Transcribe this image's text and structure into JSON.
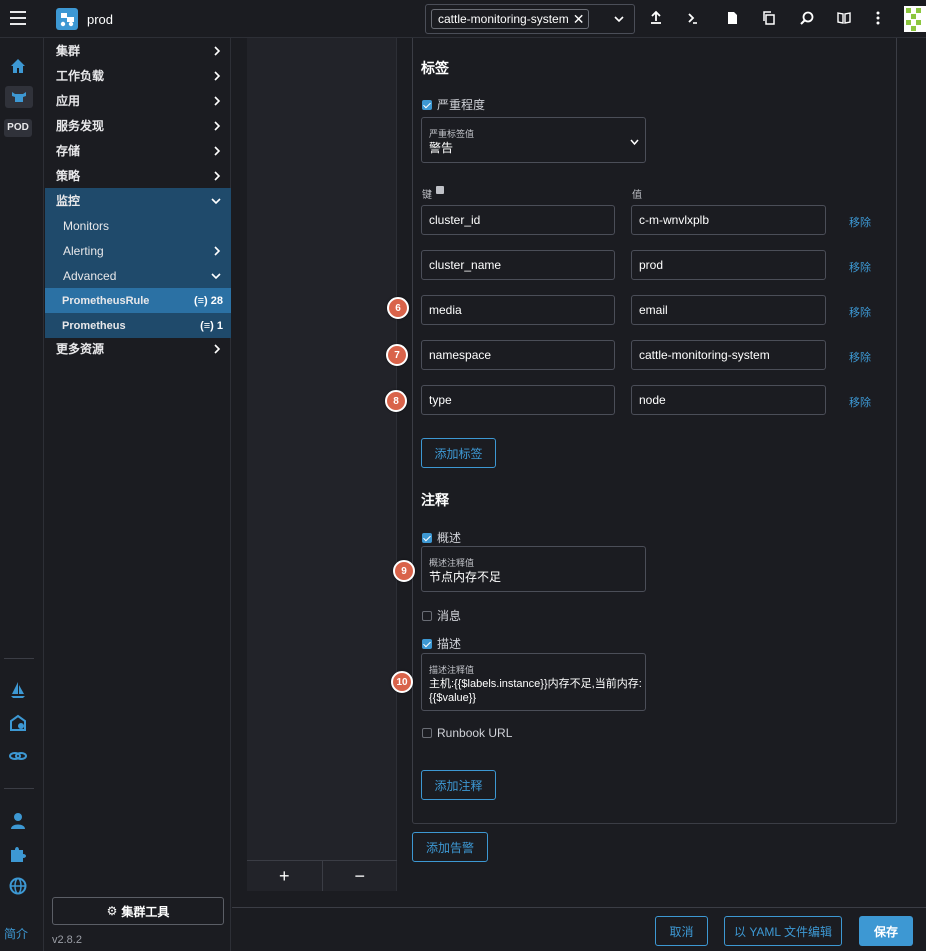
{
  "header": {
    "cluster_name": "prod",
    "namespace_chip": "cattle-monitoring-system"
  },
  "rail": {
    "pod_badge": "POD",
    "about_link": "简介"
  },
  "nav": {
    "items": [
      {
        "label": "集群"
      },
      {
        "label": "工作负载"
      },
      {
        "label": "应用"
      },
      {
        "label": "服务发现"
      },
      {
        "label": "存储"
      },
      {
        "label": "策略"
      },
      {
        "label": "监控"
      },
      {
        "label": "Monitors"
      },
      {
        "label": "Alerting"
      },
      {
        "label": "Advanced"
      },
      {
        "label": "PrometheusRule",
        "count": "28"
      },
      {
        "label": "Prometheus",
        "count": "1"
      },
      {
        "label": "更多资源"
      }
    ],
    "cluster_tools": "集群工具",
    "version": "v2.8.2"
  },
  "tabs": {
    "add": "+",
    "remove": "−"
  },
  "labels_section": {
    "title": "标签",
    "severity_checkbox": "严重程度",
    "severity_field_label": "严重标签值",
    "severity_value": "警告",
    "key_header": "键",
    "value_header": "值",
    "rows": [
      {
        "key": "cluster_id",
        "value": "c-m-wnvlxplb",
        "remove": "移除"
      },
      {
        "key": "cluster_name",
        "value": "prod",
        "remove": "移除"
      },
      {
        "key": "media",
        "value": "email",
        "remove": "移除"
      },
      {
        "key": "namespace",
        "value": "cattle-monitoring-system",
        "remove": "移除"
      },
      {
        "key": "type",
        "value": "node",
        "remove": "移除"
      }
    ],
    "add_label_button": "添加标签"
  },
  "annotations_section": {
    "title": "注释",
    "summary_checkbox": "概述",
    "summary_field_label": "概述注释值",
    "summary_value": "节点内存不足",
    "message_checkbox": "消息",
    "description_checkbox": "描述",
    "description_field_label": "描述注释值",
    "description_value_line1": "主机:{{$labels.instance}}内存不足,当前内存:",
    "description_value_line2": "{{$value}}",
    "runbook_checkbox": "Runbook URL",
    "add_annotation_button": "添加注释"
  },
  "add_alert_button": "添加告警",
  "steps": {
    "s6": "6",
    "s7": "7",
    "s8": "8",
    "s9": "9",
    "s10": "10"
  },
  "footer": {
    "cancel": "取消",
    "edit_yaml": "以 YAML 文件编辑",
    "save": "保存"
  },
  "colors": {
    "accent": "#3d98d3",
    "step_badge": "#d9634a",
    "nav_active": "#2b71a4",
    "background": "#1b1c21"
  }
}
